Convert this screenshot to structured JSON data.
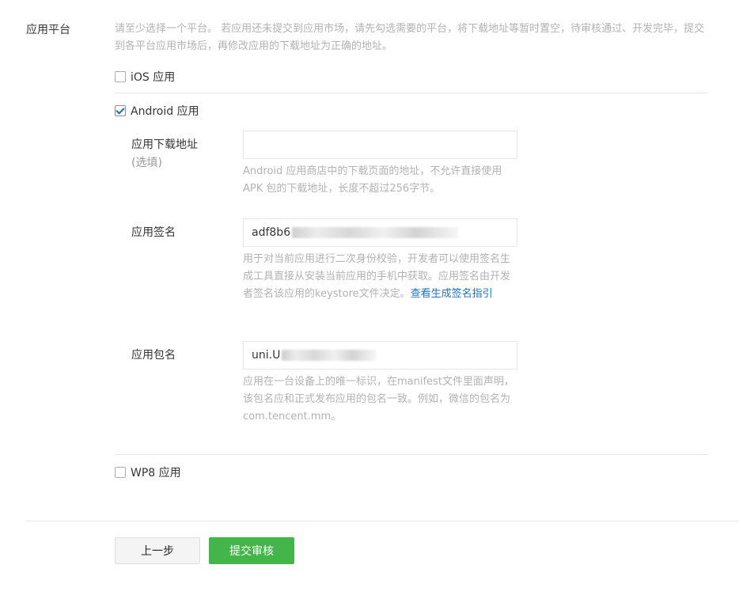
{
  "section": {
    "label": "应用平台",
    "intro": "请至少选择一个平台。 若应用还未提交到应用市场，请先勾选需要的平台，将下载地址等暂时置空，待审核通过、开发完毕，提交到各平台应用市场后，再修改应用的下载地址为正确的地址。"
  },
  "platforms": {
    "ios": {
      "label": "iOS 应用",
      "checked": false
    },
    "android": {
      "label": "Android 应用",
      "checked": true,
      "download": {
        "label": "应用下载地址",
        "sub": "(选填)",
        "value": "",
        "help": "Android 应用商店中的下载页面的地址，不允许直接使用 APK 包的下载地址，长度不超过256字节。"
      },
      "signature": {
        "label": "应用签名",
        "value": "adf8b6",
        "help": "用于对当前应用进行二次身份校验，开发者可以使用签名生成工具直接从安装当前应用的手机中获取。应用签名由开发者签名该应用的keystore文件决定。",
        "help_link": "查看生成签名指引"
      },
      "package": {
        "label": "应用包名",
        "value": "uni.U",
        "help": "应用在一台设备上的唯一标识，在manifest文件里面声明，该包名应和正式发布应用的包名一致。例如，微信的包名为com.tencent.mm。"
      }
    },
    "wp8": {
      "label": "WP8 应用",
      "checked": false
    }
  },
  "actions": {
    "prev": "上一步",
    "submit": "提交审核"
  },
  "colors": {
    "primary_green": "#44b549",
    "link_blue": "#1a73c7",
    "help_gray": "#b2b2b2"
  }
}
